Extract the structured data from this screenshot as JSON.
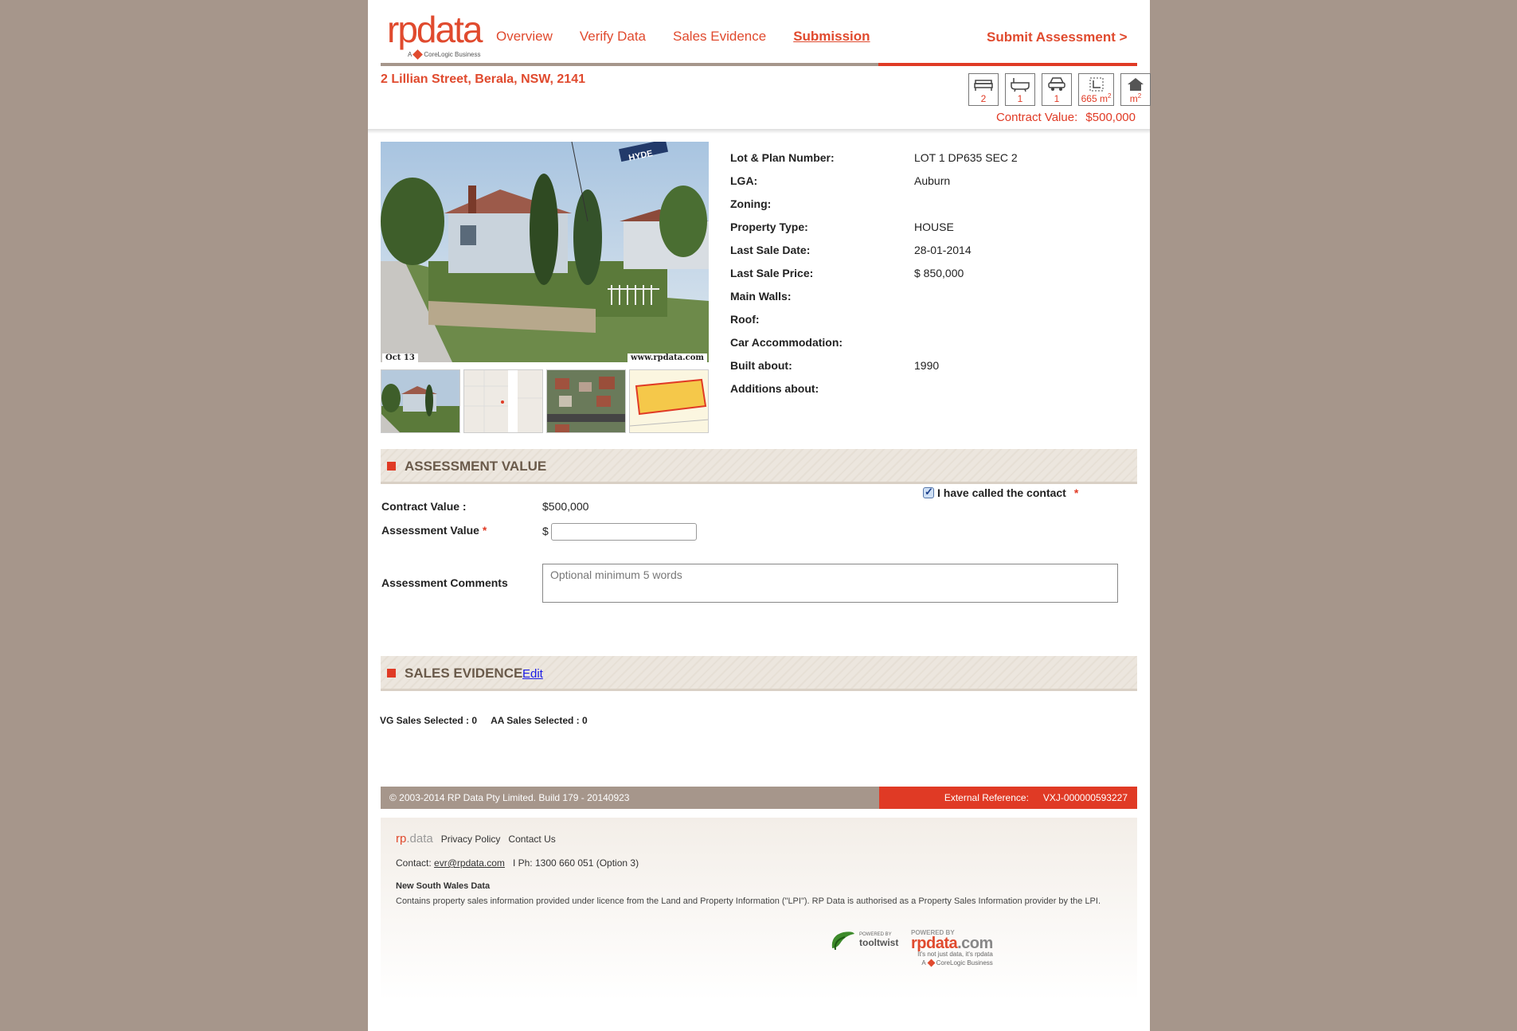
{
  "brand": {
    "logo": "rpdata",
    "logo_sub_a": "A",
    "logo_sub": "CoreLogic Business"
  },
  "nav": {
    "items": [
      "Overview",
      "Verify Data",
      "Sales Evidence",
      "Submission"
    ],
    "active": "Submission",
    "submit": "Submit Assessment >"
  },
  "property": {
    "address": "2 Lillian Street, Berala, NSW, 2141",
    "features": {
      "beds": "2",
      "baths": "1",
      "cars": "1",
      "land": "665 m",
      "land_sup": "2",
      "floor": "m",
      "floor_sup": "2"
    },
    "contract_label": "Contract Value:",
    "contract_value": "$500,000"
  },
  "photo": {
    "date": "Oct 13",
    "site": "www.rpdata.com",
    "street_sign": "HYDE"
  },
  "details": [
    {
      "label": "Lot & Plan Number:",
      "value": "LOT 1 DP635 SEC 2"
    },
    {
      "label": "LGA:",
      "value": "Auburn"
    },
    {
      "label": "Zoning:",
      "value": ""
    },
    {
      "label": "Property Type:",
      "value": "HOUSE"
    },
    {
      "label": "Last Sale Date:",
      "value": "28-01-2014"
    },
    {
      "label": "Last Sale Price:",
      "value": "$ 850,000"
    },
    {
      "label": "Main Walls:",
      "value": ""
    },
    {
      "label": "Roof:",
      "value": ""
    },
    {
      "label": "Car Accommodation:",
      "value": ""
    },
    {
      "label": "Built about:",
      "value": "1990"
    },
    {
      "label": "Additions about:",
      "value": ""
    }
  ],
  "assessment": {
    "title": "ASSESSMENT VALUE",
    "called_label": "I have called the contact",
    "required_mark": "*",
    "contract_label": "Contract Value :",
    "contract_value": "$500,000",
    "assessment_label": "Assessment Value",
    "currency": "$",
    "assessment_value": "",
    "comments_label": "Assessment Comments",
    "comments_placeholder": "Optional minimum 5 words"
  },
  "sales_evidence": {
    "title": "SALES EVIDENCE",
    "edit": "Edit",
    "vg": "VG Sales Selected : 0",
    "aa": "AA Sales Selected : 0"
  },
  "footer": {
    "copyright": "© 2003-2014 RP Data Pty Limited.  Build 179 - 20140923",
    "ext_label": "External Reference:",
    "ext_value": "VXJ-000000593227",
    "logo_rp": "rp",
    "logo_data": ".data",
    "privacy": "Privacy Policy",
    "contact_us": "Contact Us",
    "contact_label": "Contact:",
    "email": "evr@rpdata.com",
    "phone": "I   Ph: 1300 660 051 (Option 3)",
    "nsw_title": "New South Wales Data",
    "nsw_text": "Contains property sales information provided under licence from the Land and Property Information (\"LPI\"). RP Data is authorised as a Property Sales Information provider by the LPI.",
    "tt_powered": "POWERED BY",
    "tt_name": "tooltwist",
    "rp_powered": "POWERED BY",
    "rp_name": "rpdata",
    "rp_dotcom": ".com",
    "rp_tag": "It's not just data, it's rpdata",
    "rp_cl_a": "A",
    "rp_cl": "CoreLogic Business"
  }
}
